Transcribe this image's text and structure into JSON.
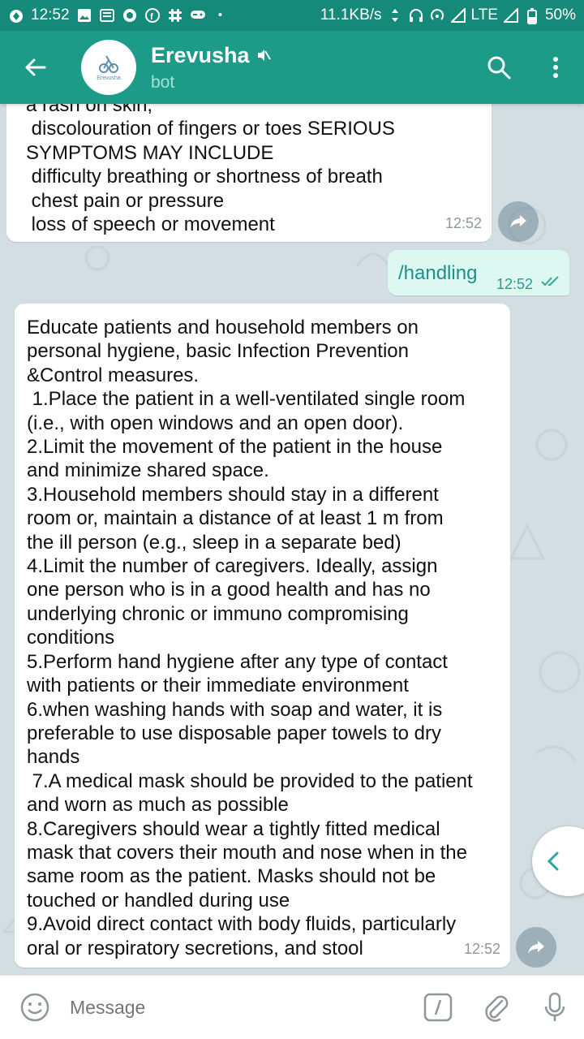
{
  "status_bar": {
    "time": "12:52",
    "speed": "11.1KB/s",
    "network": "LTE",
    "battery": "50%"
  },
  "header": {
    "title": "Erevusha",
    "subtitle": "bot",
    "avatar_text": "Erevusha",
    "accent_color": "#1d9b89",
    "icons": [
      "back-arrow-icon",
      "mute-icon",
      "search-icon",
      "more-vert-icon"
    ]
  },
  "messages": [
    {
      "direction": "incoming",
      "lines": [
        "a rash on skin,",
        " discolouration of fingers or toes SERIOUS",
        "SYMPTOMS MAY INCLUDE",
        " difficulty breathing or shortness of breath",
        " chest pain or pressure",
        " loss of speech or movement"
      ],
      "time": "12:52"
    },
    {
      "direction": "outgoing",
      "text": "/handling",
      "time": "12:52",
      "status": "read"
    },
    {
      "direction": "incoming",
      "lines": [
        "Educate patients and household members on",
        "personal hygiene, basic Infection Prevention",
        "&Control measures.",
        " 1.Place the patient in a well-ventilated single room",
        "(i.e., with open windows and an open door).",
        "2.Limit the movement of the patient in the house",
        "and minimize shared space.",
        "3.Household members should stay in a different",
        "room or, maintain a distance of at least 1 m from",
        "the ill person (e.g., sleep in a separate bed)",
        "4.Limit the number of caregivers. Ideally, assign",
        "one person who is in a good health and has no",
        "underlying chronic or immuno compromising",
        "conditions",
        "5.Perform hand hygiene after any type of contact",
        "with patients or their immediate environment",
        "6.when washing hands with soap and water, it is",
        "preferable to use disposable paper towels to dry",
        "hands",
        " 7.A medical mask should be provided to the patient",
        "and worn as much as possible",
        "8.Caregivers should wear a tightly fitted medical",
        "mask that covers their mouth and nose when in the",
        "same room as the patient. Masks should not be",
        "touched or handled during use",
        "9.Avoid direct contact with body fluids, particularly",
        "oral or respiratory secretions, and stool"
      ],
      "time": "12:52"
    }
  ],
  "input": {
    "placeholder": "Message"
  }
}
